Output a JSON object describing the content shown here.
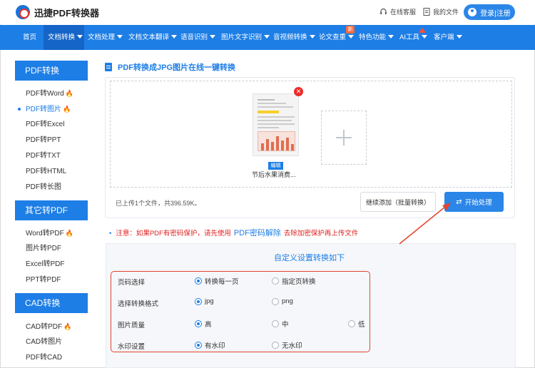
{
  "header": {
    "logo_text": "迅捷PDF转换器",
    "service_label": "在线客服",
    "files_label": "我的文件",
    "login_label": "登录|注册"
  },
  "nav": {
    "items": [
      {
        "label": "首页",
        "has_caret": false
      },
      {
        "label": "文档转换",
        "has_caret": true,
        "active": true
      },
      {
        "label": "文档处理",
        "has_caret": true
      },
      {
        "label": "文档文本翻译",
        "has_caret": true
      },
      {
        "label": "语音识别",
        "has_caret": true
      },
      {
        "label": "图片文字识别",
        "has_caret": true
      },
      {
        "label": "音视频转换",
        "has_caret": true
      },
      {
        "label": "论文查重",
        "has_caret": true
      },
      {
        "label": "特色功能",
        "has_caret": true
      },
      {
        "label": "AI工具",
        "has_caret": true
      },
      {
        "label": "客户端",
        "has_caret": true
      }
    ],
    "new_badge": "新",
    "accent": "#1d7ee6"
  },
  "sidebar": {
    "groups": [
      {
        "title": "PDF转换",
        "items": [
          {
            "label": "PDF转Word",
            "hot": true
          },
          {
            "label": "PDF转图片",
            "hot": true,
            "active": true
          },
          {
            "label": "PDF转Excel"
          },
          {
            "label": "PDF转PPT"
          },
          {
            "label": "PDF转TXT"
          },
          {
            "label": "PDF转HTML"
          },
          {
            "label": "PDF转长图"
          }
        ]
      },
      {
        "title": "其它转PDF",
        "items": [
          {
            "label": "Word转PDF",
            "hot": true
          },
          {
            "label": "图片转PDF"
          },
          {
            "label": "Excel转PDF"
          },
          {
            "label": "PPT转PDF"
          }
        ]
      },
      {
        "title": "CAD转换",
        "items": [
          {
            "label": "CAD转PDF",
            "hot": true
          },
          {
            "label": "CAD转图片"
          },
          {
            "label": "PDF转CAD"
          }
        ]
      }
    ]
  },
  "main": {
    "page_title": "PDF转换成JPG图片在线一键转换",
    "file": {
      "edit_label": "编辑",
      "name": "节后水果消费..."
    },
    "status": "已上传1个文件，共396.59K。",
    "continue_label": "继续添加（批量转换）",
    "start_label": "开始处理",
    "note": {
      "prefix": "注意：如果PDF有密码保护，请先使用",
      "link": "PDF密码解除",
      "suffix": "去除加密保护再上传文件"
    },
    "settings": {
      "title": "自定义设置转换如下",
      "rows": [
        {
          "label": "页码选择",
          "options": [
            "转换每一页",
            "指定页转换"
          ],
          "selected": 0
        },
        {
          "label": "选择转换格式",
          "options": [
            "jpg",
            "png"
          ],
          "selected": 0
        },
        {
          "label": "图片质量",
          "options": [
            "高",
            "中",
            "低"
          ],
          "selected": 0
        },
        {
          "label": "水印设置",
          "options": [
            "有水印",
            "无水印"
          ],
          "selected": 0
        }
      ]
    }
  },
  "icons": {
    "headset": "headset-icon",
    "file": "file-icon",
    "user": "user-icon",
    "fire": "fire-icon",
    "plus": "plus-icon",
    "close": "close-icon",
    "swap": "swap-icon"
  }
}
